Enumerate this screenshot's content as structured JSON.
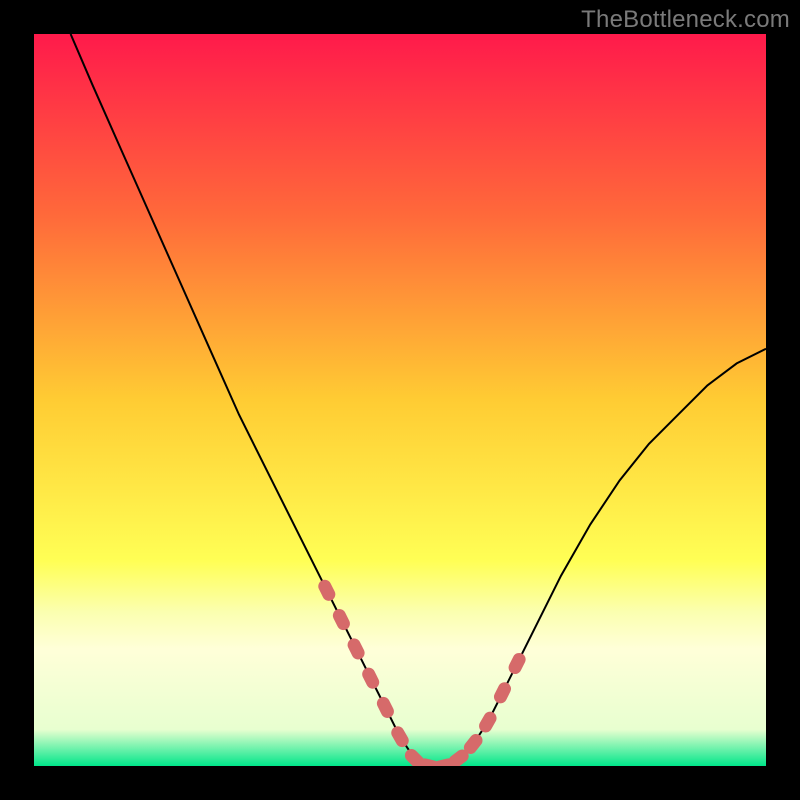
{
  "watermark": "TheBottleneck.com",
  "chart_data": {
    "type": "line",
    "title": "",
    "xlabel": "",
    "ylabel": "",
    "xlim": [
      0,
      100
    ],
    "ylim": [
      0,
      100
    ],
    "grid": false,
    "legend": false,
    "background_gradient": {
      "stops": [
        {
          "pos": 0.0,
          "color": "#ff1a4b"
        },
        {
          "pos": 0.25,
          "color": "#ff6a3a"
        },
        {
          "pos": 0.5,
          "color": "#ffcc33"
        },
        {
          "pos": 0.72,
          "color": "#ffff55"
        },
        {
          "pos": 0.79,
          "color": "#fbffb0"
        },
        {
          "pos": 0.84,
          "color": "#ffffd8"
        },
        {
          "pos": 0.95,
          "color": "#e8ffd0"
        },
        {
          "pos": 1.0,
          "color": "#00e68a"
        }
      ]
    },
    "series": [
      {
        "name": "bottleneck-curve",
        "stroke": "#000000",
        "x": [
          5,
          8,
          12,
          16,
          20,
          24,
          28,
          32,
          36,
          40,
          44,
          46,
          48,
          50,
          52,
          54,
          56,
          58,
          60,
          62,
          64,
          68,
          72,
          76,
          80,
          84,
          88,
          92,
          96,
          100
        ],
        "y": [
          100,
          93,
          84,
          75,
          66,
          57,
          48,
          40,
          32,
          24,
          16,
          12,
          8,
          4,
          1,
          0,
          0,
          1,
          3,
          6,
          10,
          18,
          26,
          33,
          39,
          44,
          48,
          52,
          55,
          57
        ]
      }
    ],
    "markers": {
      "name": "highlighted-points",
      "color": "#d66a6a",
      "x": [
        40,
        42,
        44,
        46,
        48,
        50,
        52,
        54,
        56,
        58,
        60,
        62,
        64,
        66
      ],
      "y": [
        24,
        20,
        16,
        12,
        8,
        4,
        1,
        0,
        0,
        1,
        3,
        6,
        10,
        14
      ]
    }
  }
}
